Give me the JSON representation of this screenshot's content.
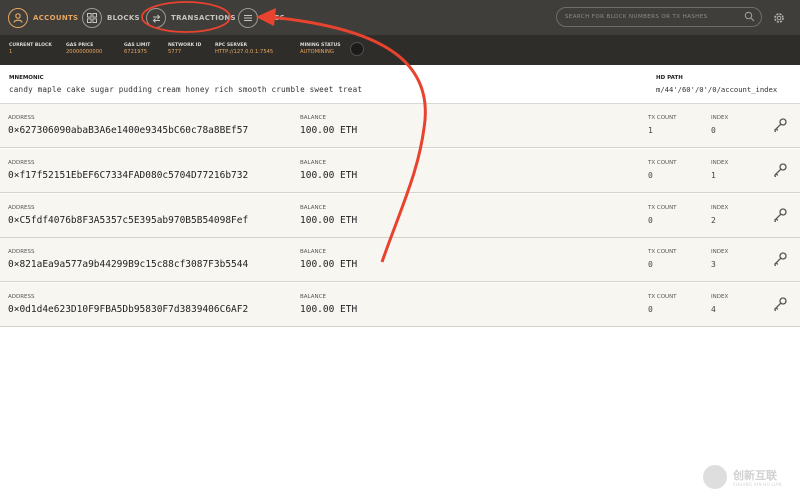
{
  "nav": {
    "accounts": "ACCOUNTS",
    "blocks": "BLOCKS",
    "transactions": "TRANSACTIONS",
    "logs": "LOGS"
  },
  "search": {
    "placeholder": "SEARCH FOR BLOCK NUMBERS OR TX HASHES"
  },
  "status": [
    {
      "label": "CURRENT BLOCK",
      "value": "1"
    },
    {
      "label": "GAS PRICE",
      "value": "20000000000"
    },
    {
      "label": "GAS LIMIT",
      "value": "6721975"
    },
    {
      "label": "NETWORK ID",
      "value": "5777"
    },
    {
      "label": "RPC SERVER",
      "value": "HTTP://127.0.0.1:7545"
    },
    {
      "label": "MINING STATUS",
      "value": "AUTOMINING"
    }
  ],
  "mnemonic": {
    "label": "MNEMONIC",
    "value": "candy maple cake sugar pudding cream honey rich smooth crumble sweet treat",
    "hd_label": "HD PATH",
    "hd_value": "m/44'/60'/0'/0/account_index"
  },
  "columns": {
    "address": "ADDRESS",
    "balance": "BALANCE",
    "tx_count": "TX COUNT",
    "index": "INDEX"
  },
  "accounts": [
    {
      "address": "0×627306090abaB3A6e1400e9345bC60c78a8BEf57",
      "balance": "100.00 ETH",
      "tx_count": "1",
      "index": "0"
    },
    {
      "address": "0×f17f52151EbEF6C7334FAD080c5704D77216b732",
      "balance": "100.00 ETH",
      "tx_count": "0",
      "index": "1"
    },
    {
      "address": "0×C5fdf4076b8F3A5357c5E395ab970B5B54098Fef",
      "balance": "100.00 ETH",
      "tx_count": "0",
      "index": "2"
    },
    {
      "address": "0×821aEa9a577a9b44299B9c15c88cf3087F3b5544",
      "balance": "100.00 ETH",
      "tx_count": "0",
      "index": "3"
    },
    {
      "address": "0×0d1d4e623D10F9FBA5Db95830F7d3839406C6AF2",
      "balance": "100.00 ETH",
      "tx_count": "0",
      "index": "4"
    }
  ],
  "watermark": {
    "text": "创新互联",
    "sub": "CHUANG XIN HU LIAN"
  },
  "colors": {
    "accent": "#e4a663",
    "nav_bg": "#3f3e3a",
    "status_bg": "#2e2d29",
    "row_bg": "#f7f6f1",
    "annotation": "#e8432e"
  },
  "icons": {
    "accounts": "person-circle-icon",
    "blocks": "grid-icon",
    "transactions": "swap-arrows-icon",
    "logs": "list-icon",
    "search": "search-icon",
    "settings": "gear-icon",
    "key": "key-icon"
  }
}
